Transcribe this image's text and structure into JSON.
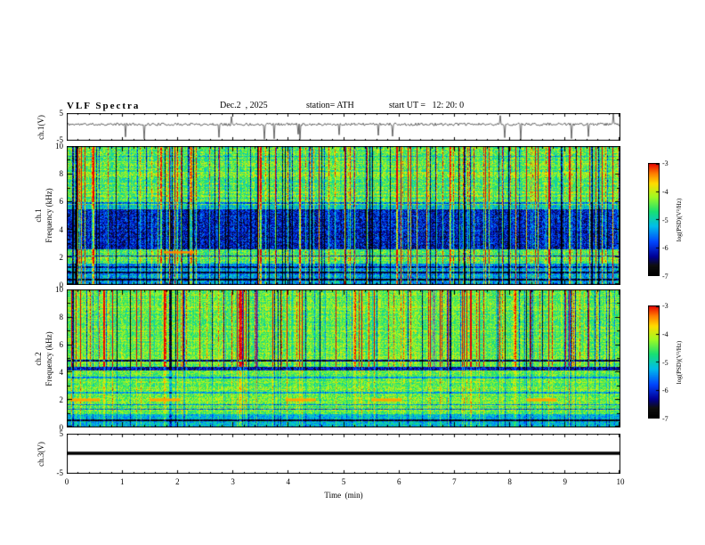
{
  "header": {
    "title": "VLF Spectra",
    "date": "Dec.2  , 2025",
    "station": "station= ATH",
    "start_ut": "start UT =   12: 20: 0"
  },
  "x_axis": {
    "label": "Time  (min)",
    "min": 0,
    "max": 10,
    "ticks": [
      0,
      1,
      2,
      3,
      4,
      5,
      6,
      7,
      8,
      9,
      10
    ]
  },
  "chart_data": [
    {
      "type": "line",
      "name": "ch1-waveform",
      "ylabel": "ch.1(V)",
      "ylim": [
        -5,
        5
      ],
      "yticks": [
        5,
        -5
      ],
      "baseline": 0.8,
      "noise_amp": 0.5,
      "spike_rate": 0.02,
      "seed": 11
    },
    {
      "type": "heatmap",
      "name": "ch1-spectrogram",
      "ylabel_lines": [
        "ch.1",
        "Frequency (kHz)"
      ],
      "ylim": [
        0,
        10
      ],
      "yticks": [
        0,
        2,
        4,
        6,
        8,
        10
      ],
      "vmin": -7,
      "vmax": -3,
      "base": -4.5,
      "noise": 1.1,
      "row_jitter": 0.5,
      "streak_up_p": 0.17,
      "streak_dn_p": 0.1,
      "bands": [
        {
          "f0": 0,
          "f1": 1.5,
          "level": -5.4
        },
        {
          "f0": 2.55,
          "f1": 5.45,
          "level": -6.1
        },
        {
          "f0": 5.45,
          "f1": 5.75,
          "level": -5.1
        }
      ],
      "hlines": [
        {
          "f": 0.35,
          "w": 0.09,
          "level": -6.9
        },
        {
          "f": 0.85,
          "w": 0.07,
          "level": -6.6
        },
        {
          "f": 1.25,
          "w": 0.05,
          "level": -6.3
        },
        {
          "f": 2.05,
          "w": 0.05,
          "level": -6.0
        },
        {
          "f": 5.9,
          "w": 0.04,
          "level": -5.6
        },
        {
          "f": 9.3,
          "w": 0.03,
          "level": -5.1
        }
      ],
      "segments": [
        {
          "x0": 1.75,
          "x1": 2.3,
          "f": 2.35,
          "w": 0.08,
          "level": -3.4
        }
      ],
      "seed": 101,
      "colorbar": {
        "label": "log(PSD)(V²/Hz)",
        "min": -7,
        "max": -3,
        "ticks": [
          -3,
          -4,
          -5,
          -6,
          -7
        ]
      }
    },
    {
      "type": "heatmap",
      "name": "ch2-spectrogram",
      "ylabel_lines": [
        "ch.2",
        "Frequency (kHz)"
      ],
      "ylim": [
        0,
        10
      ],
      "yticks": [
        0,
        2,
        4,
        6,
        8,
        10
      ],
      "vmin": -7,
      "vmax": -3,
      "base": -4.4,
      "noise": 0.95,
      "row_jitter": 0.4,
      "streak_up_p": 0.14,
      "streak_dn_p": 0.12,
      "streak_fade_below": 4.4,
      "streak_fade": 0.35,
      "bands": [
        {
          "f0": 0,
          "f1": 0.95,
          "level": -5.2
        }
      ],
      "hlines": [
        {
          "f": 0.5,
          "w": 0.08,
          "level": -6.8
        },
        {
          "f": 1.3,
          "w": 0.04,
          "level": -5.8
        },
        {
          "f": 1.6,
          "w": 0.04,
          "level": -5.5
        },
        {
          "f": 2.5,
          "w": 0.04,
          "level": -5.3
        },
        {
          "f": 3.6,
          "w": 0.04,
          "level": -5.4
        },
        {
          "f": 4.25,
          "w": 0.14,
          "level": -6.2
        },
        {
          "f": 4.85,
          "w": 0.05,
          "level": -6.5
        }
      ],
      "segments": [
        {
          "x0": 0.05,
          "x1": 0.6,
          "f": 2.0,
          "w": 0.1,
          "level": -3.5
        },
        {
          "x0": 1.5,
          "x1": 2.05,
          "f": 2.0,
          "w": 0.1,
          "level": -3.5
        },
        {
          "x0": 3.95,
          "x1": 4.5,
          "f": 2.0,
          "w": 0.1,
          "level": -3.5
        },
        {
          "x0": 5.5,
          "x1": 6.05,
          "f": 2.0,
          "w": 0.1,
          "level": -3.5
        },
        {
          "x0": 8.3,
          "x1": 8.85,
          "f": 2.0,
          "w": 0.1,
          "level": -3.5
        }
      ],
      "seed": 202,
      "colorbar": {
        "label": "log(PSD)(V²/Hz)",
        "min": -7,
        "max": -3,
        "ticks": [
          -3,
          -4,
          -5,
          -6,
          -7
        ]
      }
    },
    {
      "type": "line",
      "name": "ch3-waveform",
      "ylabel": "ch.3(V)",
      "ylim": [
        -5,
        5
      ],
      "yticks": [
        5,
        -5
      ],
      "baseline": 0,
      "flat": true,
      "seed": 31
    }
  ]
}
